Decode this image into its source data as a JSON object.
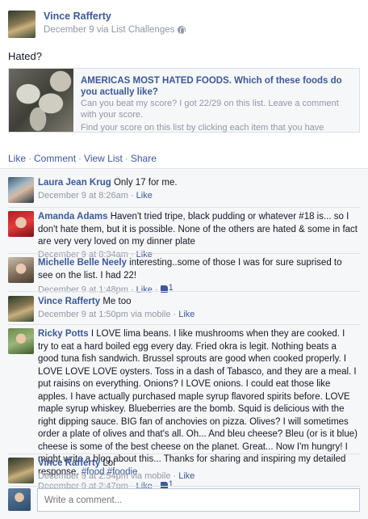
{
  "post": {
    "author": "Vince Rafferty",
    "meta": "December 9 via List Challenges",
    "text": "Hated?",
    "share": {
      "title": "AMERICAS MOST HATED FOODS. Which of these foods do you actually like?",
      "description": "Can you beat my score? I got 22/29 on this list. Leave a comment with your score.",
      "subtext": "Find your score on this list by clicking each item that you have"
    },
    "actions": [
      "Like",
      "Comment",
      "View List",
      "Share"
    ]
  },
  "comments": [
    {
      "name": "Laura Jean Krug",
      "text": "Only 17 for me.",
      "time": "December 9 at 8:26am",
      "like": "Like",
      "likes": "",
      "via": ""
    },
    {
      "name": "Amanda Adams",
      "text": "Haven't tried tripe, black pudding or whatever #18 is... so I don't hate them, but it is possible. None of the others are hated & some in fact are very very loved on my dinner plate",
      "time": "December 9 at 8:34am",
      "like": "Like",
      "likes": "",
      "via": ""
    },
    {
      "name": "Michelle Belle Neely",
      "text": "interesting..some of those I was for sure suprised to see on the list. I had 22!",
      "time": "December 9 at 1:48pm",
      "like": "Like",
      "likes": "1",
      "via": ""
    },
    {
      "name": "Vince Rafferty",
      "text": "Me too",
      "time": "December 9 at 1:50pm via mobile",
      "like": "Like",
      "likes": "",
      "via": ""
    },
    {
      "name": "Ricky Potts",
      "text": "I LOVE lima beans. I like mushrooms when they are cooked. I try to eat a hard boiled egg every day. Fried okra is legit. Nothing beats a good tuna fish sandwich. Brussel sprouts are good when cooked properly. I LOVE LOVE LOVE oysters. Toss in a dash of Tabasco, and they are a meal. I put raisins on everything. Onions? I LOVE onions. I could eat those like apples. I have actually purchased maple syrup flavored spirits before. LOVE maple syrup whiskey. Blueberries are the bomb. Squid is delicious with the right dipping sauce. BIG fan of anchovies on pizza. Olives? I will sometimes order a plate of olives and that's all. Oh... And bleu cheese? Bleu (or is it blue) cheese is some of the best cheese on the planet. Great... Now I'm hungry! I might write a blog about this... Thanks for sharing and inspiring my detailed response.",
      "tags": "#food #foodie",
      "time": "December 9 at 2:47pm",
      "like": "Like",
      "likes": "1",
      "via": ""
    },
    {
      "name": "Vince Rafferty",
      "text": "Lol",
      "time": "December 9 at 2:54pm via mobile",
      "like": "Like",
      "likes": "",
      "via": ""
    }
  ],
  "composer": {
    "placeholder": "Write a comment..."
  }
}
